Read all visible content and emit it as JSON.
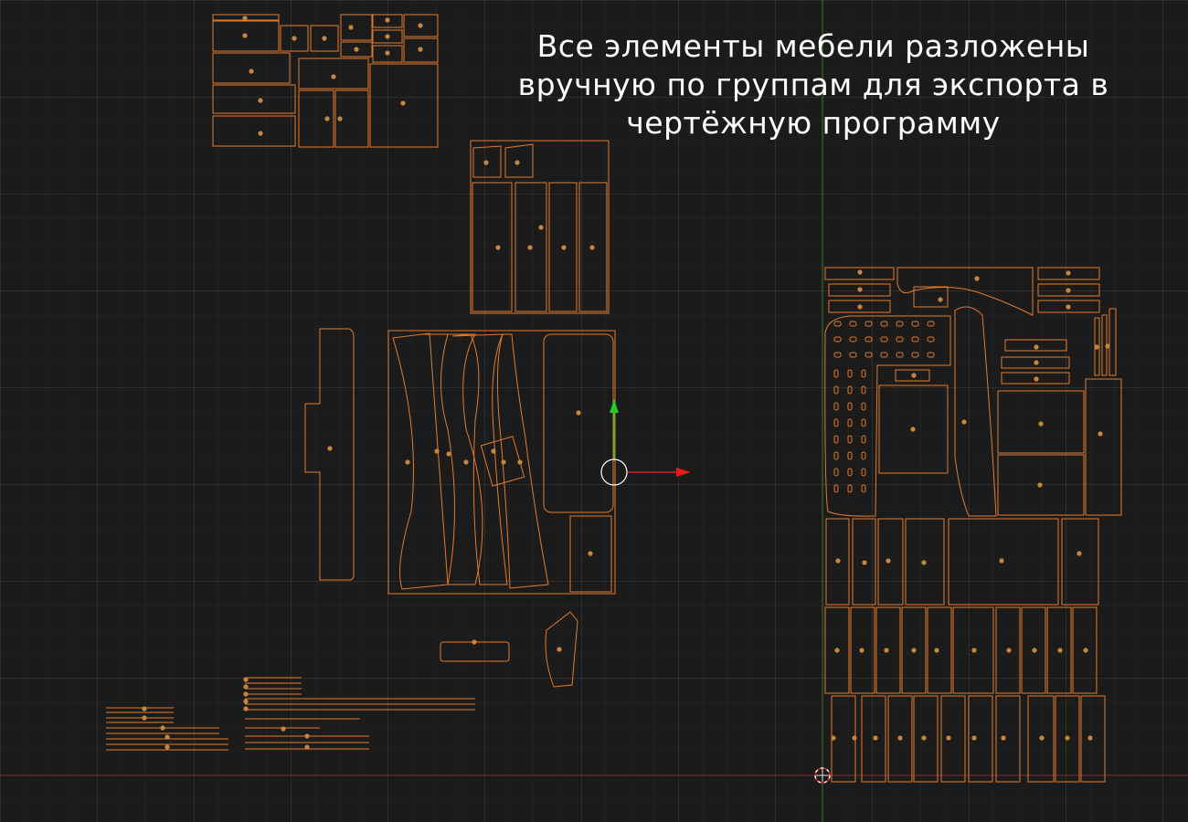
{
  "viewport": {
    "grid_color": "#3a3a3a",
    "background": "#1b1b1b",
    "outline_color": "#e07b2c",
    "origin_dot_color": "#c8863a",
    "axis_x_color": "#8a2a2a",
    "axis_y_color": "#3f8a2a"
  },
  "caption": {
    "lines": [
      "Все элементы мебели разложены",
      "вручную по группам для экспорта в",
      "чертёжную программу"
    ]
  },
  "gizmo": {
    "x_arrow_color": "#e01e1e",
    "y_arrow_color": "#22cc22",
    "ring_color": "#ffffff"
  },
  "groups": [
    "group-top-left-panels",
    "group-top-middle-panels",
    "group-side-profile",
    "group-center-cutouts",
    "group-small-parts",
    "group-strips-left",
    "group-strips-middle",
    "group-right-large-sheet"
  ]
}
